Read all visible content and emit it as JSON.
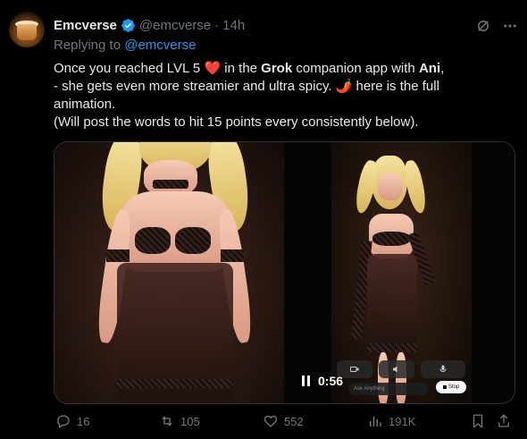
{
  "author": {
    "name": "Emcverse",
    "handle": "@emcverse",
    "separator": "·",
    "time": "14h"
  },
  "reply": {
    "prefix": "Replying to ",
    "to": "@emcverse"
  },
  "text": {
    "line1_a": "Once you reached LVL 5 ",
    "line1_heart": "❤️",
    "line1_b": " in the ",
    "line1_grok": "Grok",
    "line1_c": " companion app with ",
    "line1_ani": "Ani",
    "line1_d": ",",
    "line2": "- she gets even more streamier and ultra spicy. 🌶️  here is the full",
    "line3": "animation.",
    "line4": "(Will post the words to hit 15 points every consistently below)."
  },
  "video": {
    "time": "0:56",
    "input_placeholder": "Ask Anything",
    "stop_label": "Stop"
  },
  "actions": {
    "replies": "16",
    "reposts": "105",
    "likes": "552",
    "views": "191K"
  },
  "colors": {
    "accent": "#1d9bf0",
    "muted": "#71767b",
    "text": "#e7e9ea",
    "background": "#000000"
  }
}
